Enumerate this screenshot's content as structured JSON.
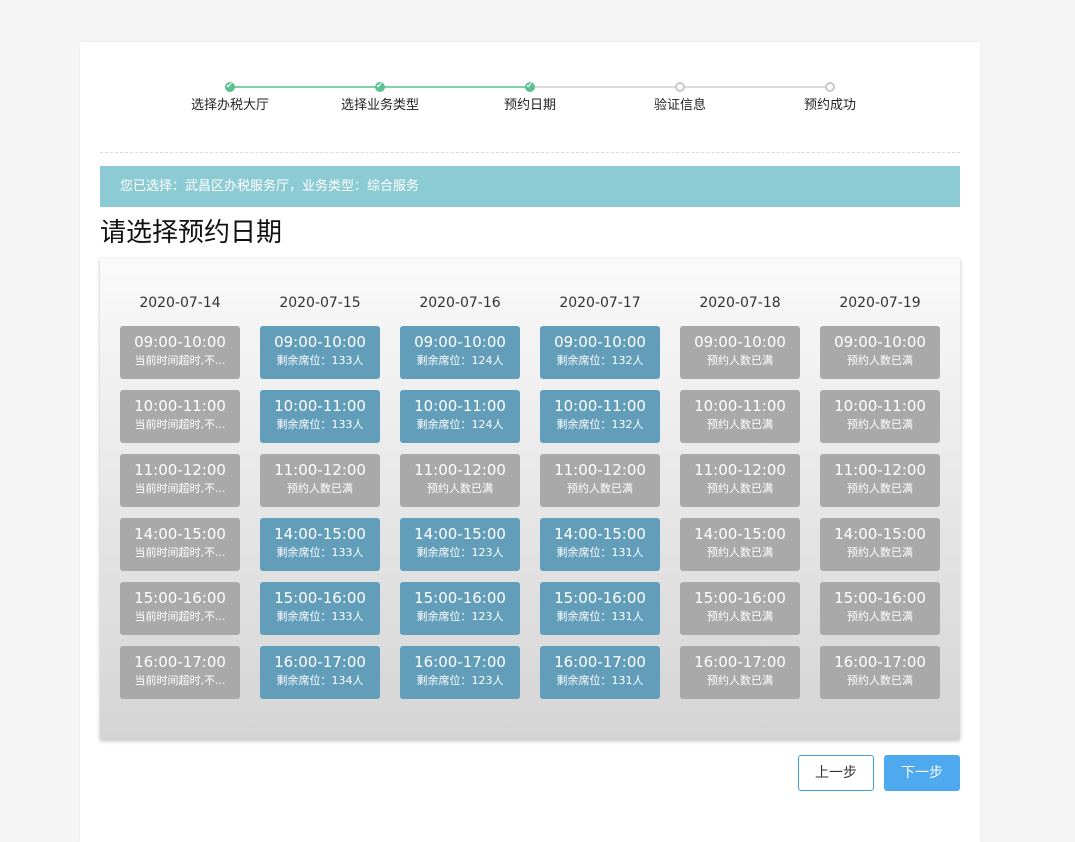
{
  "steps": [
    {
      "label": "选择办税大厅",
      "status": "done"
    },
    {
      "label": "选择业务类型",
      "status": "done"
    },
    {
      "label": "预约日期",
      "status": "done"
    },
    {
      "label": "验证信息",
      "status": "todo"
    },
    {
      "label": "预约成功",
      "status": "todo"
    }
  ],
  "notice": "您已选择：武昌区办税服务厅，业务类型：综合服务",
  "heading": "请选择预约日期",
  "schedule": [
    {
      "date": "2020-07-14",
      "slots": [
        {
          "time": "09:00-10:00",
          "info": "当前时间超时,不...",
          "status": "gray"
        },
        {
          "time": "10:00-11:00",
          "info": "当前时间超时,不...",
          "status": "gray"
        },
        {
          "time": "11:00-12:00",
          "info": "当前时间超时,不...",
          "status": "gray"
        },
        {
          "time": "14:00-15:00",
          "info": "当前时间超时,不...",
          "status": "gray"
        },
        {
          "time": "15:00-16:00",
          "info": "当前时间超时,不...",
          "status": "gray"
        },
        {
          "time": "16:00-17:00",
          "info": "当前时间超时,不...",
          "status": "gray"
        }
      ]
    },
    {
      "date": "2020-07-15",
      "slots": [
        {
          "time": "09:00-10:00",
          "info": "剩余席位：133人",
          "status": "blue"
        },
        {
          "time": "10:00-11:00",
          "info": "剩余席位：133人",
          "status": "blue"
        },
        {
          "time": "11:00-12:00",
          "info": "预约人数已满",
          "status": "gray"
        },
        {
          "time": "14:00-15:00",
          "info": "剩余席位：133人",
          "status": "blue"
        },
        {
          "time": "15:00-16:00",
          "info": "剩余席位：133人",
          "status": "blue"
        },
        {
          "time": "16:00-17:00",
          "info": "剩余席位：134人",
          "status": "blue"
        }
      ]
    },
    {
      "date": "2020-07-16",
      "slots": [
        {
          "time": "09:00-10:00",
          "info": "剩余席位：124人",
          "status": "blue"
        },
        {
          "time": "10:00-11:00",
          "info": "剩余席位：124人",
          "status": "blue"
        },
        {
          "time": "11:00-12:00",
          "info": "预约人数已满",
          "status": "gray"
        },
        {
          "time": "14:00-15:00",
          "info": "剩余席位：123人",
          "status": "blue"
        },
        {
          "time": "15:00-16:00",
          "info": "剩余席位：123人",
          "status": "blue"
        },
        {
          "time": "16:00-17:00",
          "info": "剩余席位：123人",
          "status": "blue"
        }
      ]
    },
    {
      "date": "2020-07-17",
      "slots": [
        {
          "time": "09:00-10:00",
          "info": "剩余席位：132人",
          "status": "blue"
        },
        {
          "time": "10:00-11:00",
          "info": "剩余席位：132人",
          "status": "blue"
        },
        {
          "time": "11:00-12:00",
          "info": "预约人数已满",
          "status": "gray"
        },
        {
          "time": "14:00-15:00",
          "info": "剩余席位：131人",
          "status": "blue"
        },
        {
          "time": "15:00-16:00",
          "info": "剩余席位：131人",
          "status": "blue"
        },
        {
          "time": "16:00-17:00",
          "info": "剩余席位：131人",
          "status": "blue"
        }
      ]
    },
    {
      "date": "2020-07-18",
      "slots": [
        {
          "time": "09:00-10:00",
          "info": "预约人数已满",
          "status": "gray"
        },
        {
          "time": "10:00-11:00",
          "info": "预约人数已满",
          "status": "gray"
        },
        {
          "time": "11:00-12:00",
          "info": "预约人数已满",
          "status": "gray"
        },
        {
          "time": "14:00-15:00",
          "info": "预约人数已满",
          "status": "gray"
        },
        {
          "time": "15:00-16:00",
          "info": "预约人数已满",
          "status": "gray"
        },
        {
          "time": "16:00-17:00",
          "info": "预约人数已满",
          "status": "gray"
        }
      ]
    },
    {
      "date": "2020-07-19",
      "slots": [
        {
          "time": "09:00-10:00",
          "info": "预约人数已满",
          "status": "gray"
        },
        {
          "time": "10:00-11:00",
          "info": "预约人数已满",
          "status": "gray"
        },
        {
          "time": "11:00-12:00",
          "info": "预约人数已满",
          "status": "gray"
        },
        {
          "time": "14:00-15:00",
          "info": "预约人数已满",
          "status": "gray"
        },
        {
          "time": "15:00-16:00",
          "info": "预约人数已满",
          "status": "gray"
        },
        {
          "time": "16:00-17:00",
          "info": "预约人数已满",
          "status": "gray"
        }
      ]
    }
  ],
  "buttons": {
    "prev": "上一步",
    "next": "下一步"
  },
  "colors": {
    "step_done": "#5cc091",
    "notice_bg": "#8dcbd4",
    "slot_available": "#629eba",
    "slot_unavailable": "#a9a9a9",
    "next_button": "#4ea9ef"
  }
}
